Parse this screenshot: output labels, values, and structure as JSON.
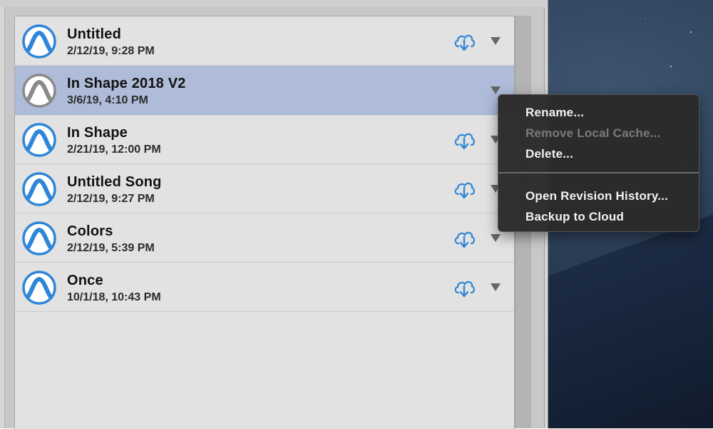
{
  "projects": [
    {
      "title": "Untitled",
      "date": "2/12/19, 9:28 PM",
      "selected": false,
      "cloud": true
    },
    {
      "title": "In Shape 2018 V2",
      "date": "3/6/19, 4:10 PM",
      "selected": true,
      "cloud": false
    },
    {
      "title": "In Shape",
      "date": "2/21/19, 12:00 PM",
      "selected": false,
      "cloud": true
    },
    {
      "title": "Untitled Song",
      "date": "2/12/19, 9:27 PM",
      "selected": false,
      "cloud": true
    },
    {
      "title": "Colors",
      "date": "2/12/19, 5:39 PM",
      "selected": false,
      "cloud": true
    },
    {
      "title": "Once",
      "date": "10/1/18, 10:43 PM",
      "selected": false,
      "cloud": true
    }
  ],
  "context_menu": {
    "items": [
      {
        "label": "Rename...",
        "enabled": true
      },
      {
        "label": "Remove Local Cache...",
        "enabled": false
      },
      {
        "label": "Delete...",
        "enabled": true
      },
      {
        "label": "Open Revision History...",
        "enabled": true
      },
      {
        "label": "Backup to Cloud",
        "enabled": true
      }
    ]
  },
  "colors": {
    "selected_row": "#aebcd9",
    "icon_blue": "#2f86d8",
    "icon_gray": "#8a8a8a",
    "cloud_blue": "#2f86d8",
    "menu_bg": "#2a2a2a"
  },
  "icons": {
    "project": "app-logo-icon",
    "cloud": "cloud-download-icon",
    "menu": "chevron-down-icon"
  }
}
